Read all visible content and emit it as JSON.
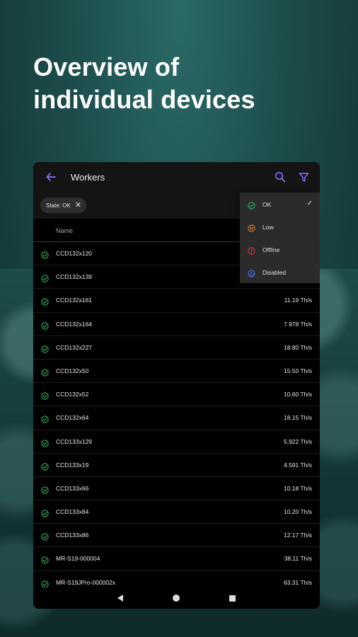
{
  "promo": {
    "headline_line1": "Overview of",
    "headline_line2": "individual devices"
  },
  "appbar": {
    "title": "Workers",
    "back_icon": "arrow-left-icon",
    "search_icon": "search-icon",
    "filter_icon": "filter-icon",
    "accent_color": "#7b61ff"
  },
  "filter_chip": {
    "label": "State: OK",
    "close_glyph": "✕"
  },
  "table": {
    "column_name": "Name",
    "rows": [
      {
        "name": "CCD132x120",
        "rate": ""
      },
      {
        "name": "CCD132x139",
        "rate": ""
      },
      {
        "name": "CCD132x161",
        "rate": "11.19 Th/s"
      },
      {
        "name": "CCD132x164",
        "rate": "7.978 Th/s"
      },
      {
        "name": "CCD132x227",
        "rate": "18.80 Th/s"
      },
      {
        "name": "CCD132x50",
        "rate": "15.50 Th/s"
      },
      {
        "name": "CCD132x52",
        "rate": "10.60 Th/s"
      },
      {
        "name": "CCD132x64",
        "rate": "18.15 Th/s"
      },
      {
        "name": "CCD133x129",
        "rate": "5.922 Th/s"
      },
      {
        "name": "CCD133x19",
        "rate": "4.591 Th/s"
      },
      {
        "name": "CCD133x66",
        "rate": "10.18 Th/s"
      },
      {
        "name": "CCD133x84",
        "rate": "10.20 Th/s"
      },
      {
        "name": "CCD133x86",
        "rate": "12.17 Th/s"
      },
      {
        "name": "MR-S19-000004",
        "rate": "38.11 Th/s"
      },
      {
        "name": "MR-S19JPro-000002x",
        "rate": "63.31 Th/s"
      }
    ]
  },
  "state_menu": {
    "items": [
      {
        "label": "OK",
        "icon": "check-circle-icon",
        "color": "#2fb463",
        "selected": true
      },
      {
        "label": "Low",
        "icon": "warning-circle-icon",
        "color": "#e07a2e",
        "selected": false
      },
      {
        "label": "Offline",
        "icon": "error-circle-icon",
        "color": "#d23b3b",
        "selected": false
      },
      {
        "label": "Disabled",
        "icon": "power-circle-icon",
        "color": "#4a6cf7",
        "selected": false
      }
    ],
    "check_glyph": "✓"
  },
  "colors": {
    "status_ok": "#2fb463"
  }
}
